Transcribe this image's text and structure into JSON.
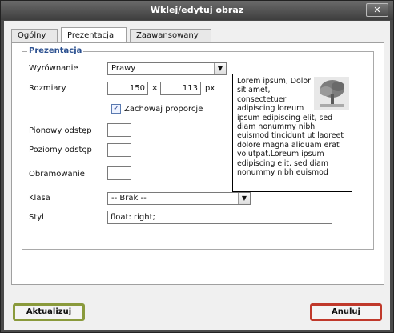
{
  "window": {
    "title": "Wklej/edytuj obraz",
    "close_label": "✕"
  },
  "tabs": [
    {
      "label": "Ogólny"
    },
    {
      "label": "Prezentacja"
    },
    {
      "label": "Zaawansowany"
    }
  ],
  "presentation": {
    "legend": "Prezentacja",
    "alignment": {
      "label": "Wyrównanie",
      "value": "Prawy"
    },
    "dimensions": {
      "label": "Rozmiary",
      "width": "150",
      "separator": "×",
      "height": "113",
      "unit": "px"
    },
    "keep_proportions": {
      "label": "Zachowaj proporcje",
      "checked": true,
      "check": "✓"
    },
    "vspace": {
      "label": "Pionowy odstęp",
      "value": ""
    },
    "hspace": {
      "label": "Poziomy odstęp",
      "value": ""
    },
    "border": {
      "label": "Obramowanie",
      "value": ""
    },
    "class": {
      "label": "Klasa",
      "value": "-- Brak --"
    },
    "style": {
      "label": "Styl",
      "value": "float: right;"
    },
    "preview_text": "Lorem ipsum, Dolor sit amet, consectetuer adipiscing loreum ipsum edipiscing elit, sed diam nonummy nibh euismod tincidunt ut laoreet dolore magna aliquam erat volutpat.Loreum ipsum edipiscing elit, sed diam nonummy nibh euismod"
  },
  "buttons": {
    "update": "Aktualizuj",
    "cancel": "Anuluj"
  },
  "colors": {
    "legend": "#2a4f8f",
    "update_border": "#8a9a3c",
    "cancel_border": "#c0392b"
  },
  "icons": {
    "dropdown": "chevron-down-icon",
    "preview": "tree-image-icon"
  }
}
